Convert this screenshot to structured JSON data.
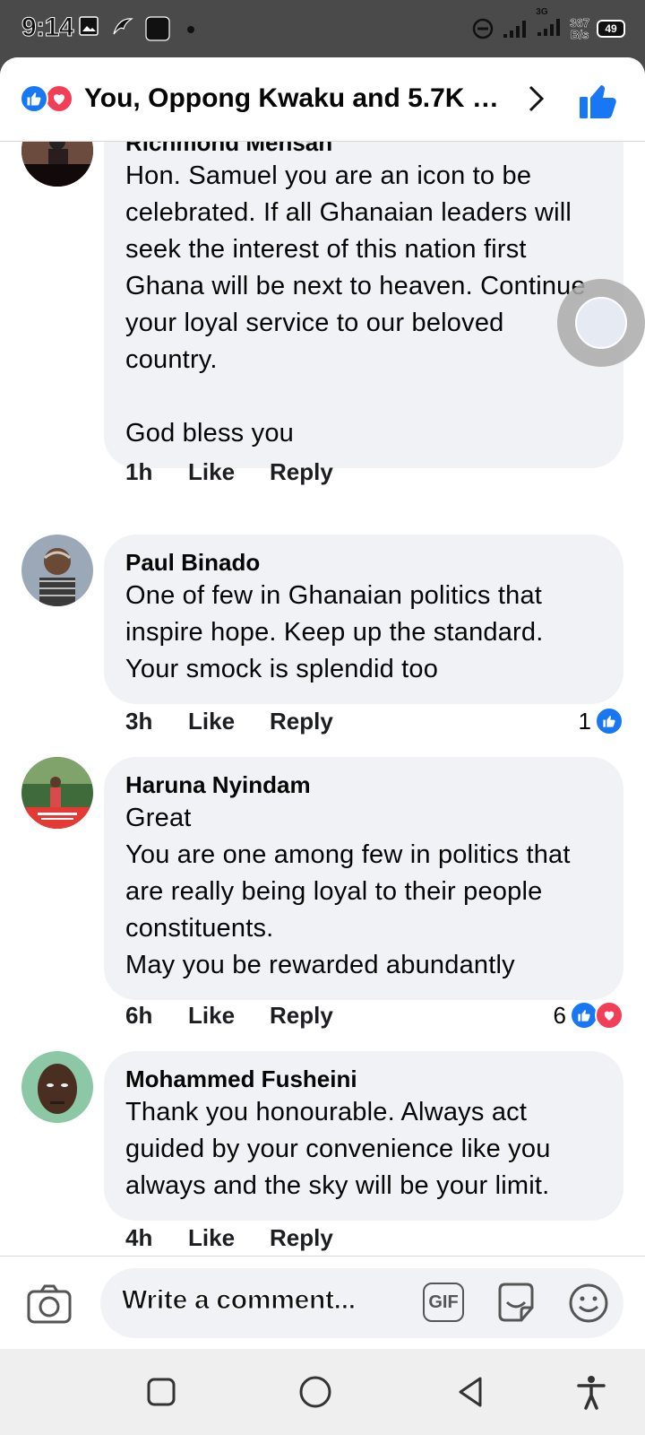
{
  "status_bar": {
    "time": "9:14",
    "network_label": "3G",
    "speed_value": "367",
    "speed_unit": "B/s",
    "battery": "49"
  },
  "header": {
    "title": "You, Oppong Kwaku and 5.7K o...",
    "icons": [
      "like-reaction-icon",
      "love-reaction-icon",
      "chevron-right-icon",
      "thumbs-up-icon"
    ]
  },
  "comments": [
    {
      "name": "Richmond Mensah",
      "text": "Hon. Samuel you are an  icon to be celebrated. If all  Ghanaian leaders will seek the interest of this nation first Ghana will be next to heaven. Continue your loyal service to our beloved country.\n\nGod bless you",
      "time": "1h",
      "like_label": "Like",
      "reply_label": "Reply",
      "reaction_count": ""
    },
    {
      "name": "Paul Binado",
      "text": "One of few in Ghanaian politics that inspire hope. Keep up the standard. Your smock is splendid too",
      "time": "3h",
      "like_label": "Like",
      "reply_label": "Reply",
      "reaction_count": "1"
    },
    {
      "name": "Haruna Nyindam",
      "text": "Great\nYou are one among few in politics that are really being loyal to their people constituents.\nMay you be rewarded abundantly",
      "time": "6h",
      "like_label": "Like",
      "reply_label": "Reply",
      "reaction_count": "6"
    },
    {
      "name": "Mohammed Fusheini",
      "text": "Thank you honourable. Always act guided by your convenience  like you always and the sky will be your limit.",
      "time": "4h",
      "like_label": "Like",
      "reply_label": "Reply",
      "reaction_count": ""
    }
  ],
  "composer": {
    "placeholder": "Write a comment...",
    "gif_label": "GIF"
  },
  "colors": {
    "facebook_blue": "#1877f2",
    "love_red": "#f33e58",
    "bubble_bg": "#f0f2f5"
  }
}
